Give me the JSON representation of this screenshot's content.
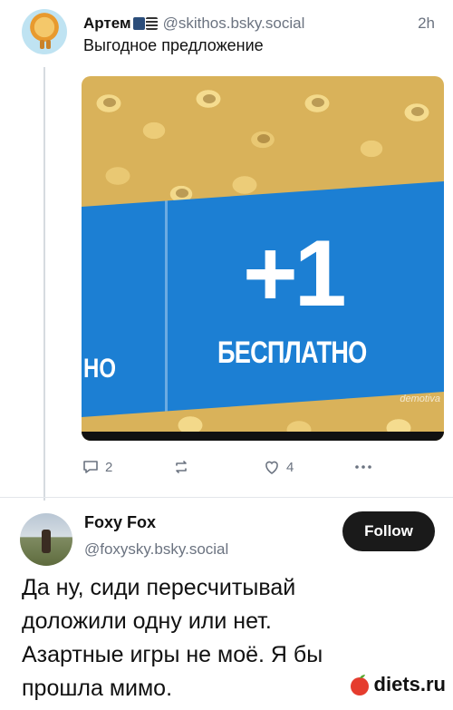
{
  "post1": {
    "author": "Артем",
    "handle": "@skithos.bsky.social",
    "time": "2h",
    "text": "Выгодное предложение",
    "image": {
      "big_text": "+1",
      "free_text": "БЕСПЛАТНО",
      "free_text_partial": "НО",
      "watermark": "demotiva"
    },
    "actions": {
      "replies": "2",
      "reposts": "",
      "likes": "4"
    }
  },
  "post2": {
    "author": "Foxy Fox",
    "handle": "@foxysky.bsky.social",
    "follow_label": "Follow",
    "lines": [
      "Да ну, сиди пересчитывай",
      "доложили одну или нет.",
      "Азартные игры не моё. Я бы",
      "прошла мимо."
    ]
  },
  "brand": "diets.ru",
  "colors": {
    "accent_blue": "#1c7fd3",
    "follow_bg": "#1a1a1a",
    "muted_text": "#6b7380"
  }
}
